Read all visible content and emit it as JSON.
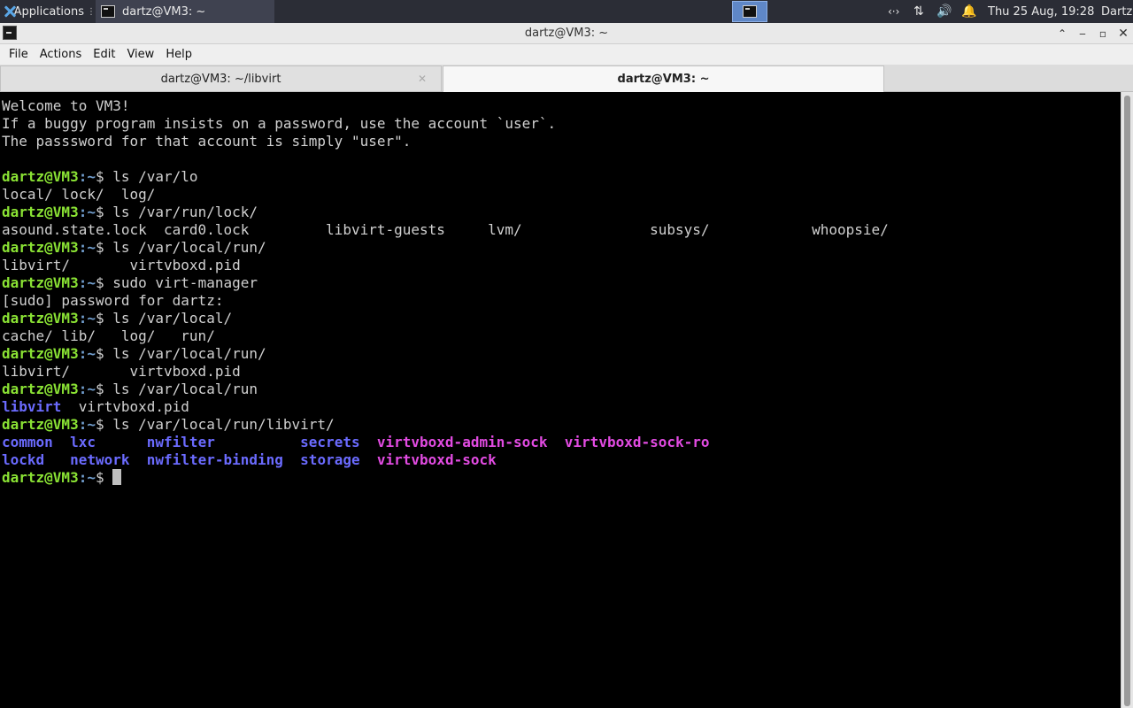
{
  "panel": {
    "apps_label": "Applications",
    "task_label": "dartz@VM3: ~",
    "net_icon": "‹·›",
    "updown_icon": "⇅",
    "volume_icon": "🔊",
    "bell_icon": "🔔",
    "clock": "Thu 25 Aug, 19:28",
    "user": "Dartz"
  },
  "window": {
    "title": "dartz@VM3: ~",
    "buttons": {
      "minimize": "‒",
      "shade": "⌄",
      "maximize": "▫",
      "close": "✕"
    }
  },
  "menubar": [
    "File",
    "Actions",
    "Edit",
    "View",
    "Help"
  ],
  "tabs": [
    {
      "label": "dartz@VM3: ~/libvirt",
      "active": false
    },
    {
      "label": "dartz@VM3: ~",
      "active": true
    }
  ],
  "terminal": {
    "prompt_user": "dartz@VM3",
    "prompt_path": ":~",
    "prompt_symbol": "$ ",
    "lines": [
      {
        "kind": "text",
        "text": "Welcome to VM3!"
      },
      {
        "kind": "text",
        "text": "If a buggy program insists on a password, use the account `user`."
      },
      {
        "kind": "text",
        "text": "The passsword for that account is simply \"user\"."
      },
      {
        "kind": "text",
        "text": ""
      },
      {
        "kind": "cmd",
        "text": "ls /var/lo"
      },
      {
        "kind": "text",
        "text": "local/ lock/  log/"
      },
      {
        "kind": "cmd",
        "text": "ls /var/run/lock/"
      },
      {
        "kind": "text",
        "text": "asound.state.lock  card0.lock         libvirt-guests     lvm/               subsys/            whoopsie/"
      },
      {
        "kind": "cmd",
        "text": "ls /var/local/run/"
      },
      {
        "kind": "text",
        "text": "libvirt/       virtvboxd.pid"
      },
      {
        "kind": "cmd",
        "text": "sudo virt-manager"
      },
      {
        "kind": "text",
        "text": "[sudo] password for dartz:"
      },
      {
        "kind": "cmd",
        "text": "ls /var/local/"
      },
      {
        "kind": "text",
        "text": "cache/ lib/   log/   run/"
      },
      {
        "kind": "cmd",
        "text": "ls /var/local/run/"
      },
      {
        "kind": "text",
        "text": "libvirt/       virtvboxd.pid"
      },
      {
        "kind": "cmd",
        "text": "ls /var/local/run"
      },
      {
        "kind": "colored",
        "segments": [
          {
            "text": "libvirt",
            "cls": "dir-blue"
          },
          {
            "text": "  virtvboxd.pid",
            "cls": ""
          }
        ]
      },
      {
        "kind": "cmd",
        "text": "ls /var/local/run/libvirt/"
      },
      {
        "kind": "colored",
        "segments": [
          {
            "text": "common",
            "cls": "dir-blue"
          },
          {
            "text": "  ",
            "cls": ""
          },
          {
            "text": "lxc",
            "cls": "dir-blue"
          },
          {
            "text": "      ",
            "cls": ""
          },
          {
            "text": "nwfilter",
            "cls": "dir-blue"
          },
          {
            "text": "          ",
            "cls": ""
          },
          {
            "text": "secrets",
            "cls": "dir-blue"
          },
          {
            "text": "  ",
            "cls": ""
          },
          {
            "text": "virtvboxd-admin-sock",
            "cls": "sock-magenta"
          },
          {
            "text": "  ",
            "cls": ""
          },
          {
            "text": "virtvboxd-sock-ro",
            "cls": "sock-magenta"
          }
        ]
      },
      {
        "kind": "colored",
        "segments": [
          {
            "text": "lockd",
            "cls": "dir-blue"
          },
          {
            "text": "   ",
            "cls": ""
          },
          {
            "text": "network",
            "cls": "dir-blue"
          },
          {
            "text": "  ",
            "cls": ""
          },
          {
            "text": "nwfilter-binding",
            "cls": "dir-blue"
          },
          {
            "text": "  ",
            "cls": ""
          },
          {
            "text": "storage",
            "cls": "dir-blue"
          },
          {
            "text": "  ",
            "cls": ""
          },
          {
            "text": "virtvboxd-sock",
            "cls": "sock-magenta"
          }
        ]
      },
      {
        "kind": "prompt",
        "text": ""
      }
    ]
  }
}
